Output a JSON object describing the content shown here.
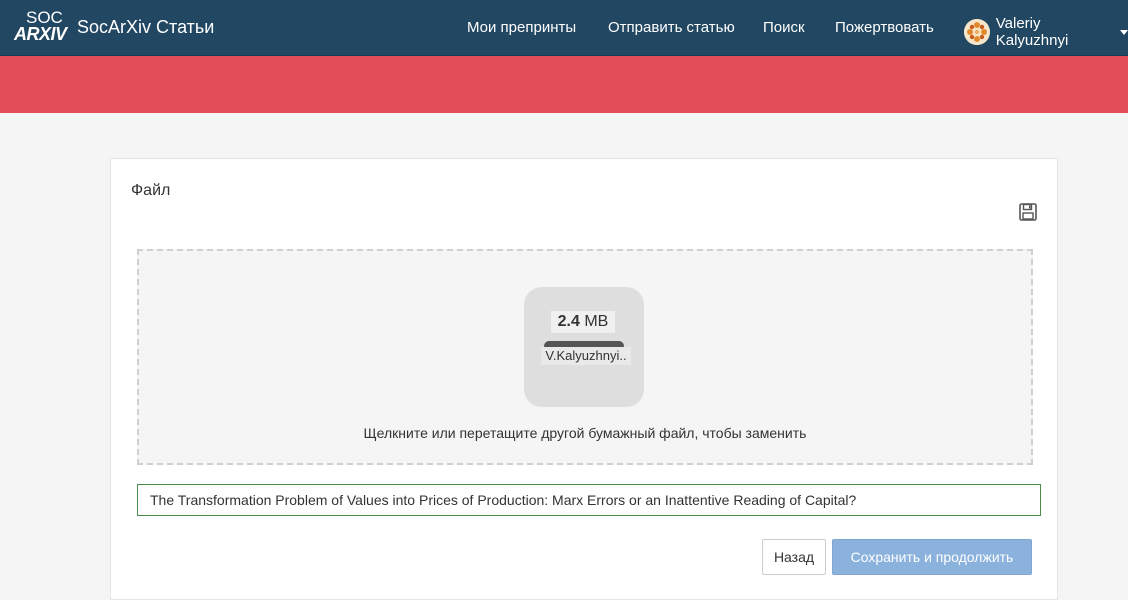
{
  "navbar": {
    "logo_top": "SOC",
    "logo_bottom": "ARXIV",
    "brand_title": "SocArXiv Статьи",
    "items": [
      {
        "label": "Мои препринты"
      },
      {
        "label": "Отправить статью"
      },
      {
        "label": "Поиск"
      },
      {
        "label": "Пожертвовать"
      }
    ],
    "user_name": "Valeriy Kalyuzhnyi"
  },
  "panel": {
    "title": "Файл",
    "file": {
      "size_value": "2.4",
      "size_unit": "MB",
      "name": "V.Kalyuzhnyi.."
    },
    "dropzone_message": "Щелкните или перетащите другой бумажный файл, чтобы заменить",
    "title_input_value": "The Transformation Problem of Values into Prices of Production: Marx Errors or an Inattentive Reading of Capital?",
    "back_label": "Назад",
    "save_label": "Сохранить и продолжить"
  },
  "colors": {
    "navbar": "#214762",
    "banner": "#e14c57",
    "save_button": "#8ab2dd"
  },
  "icons": [
    "avatar-identicon",
    "caret-down-icon",
    "save-icon"
  ]
}
